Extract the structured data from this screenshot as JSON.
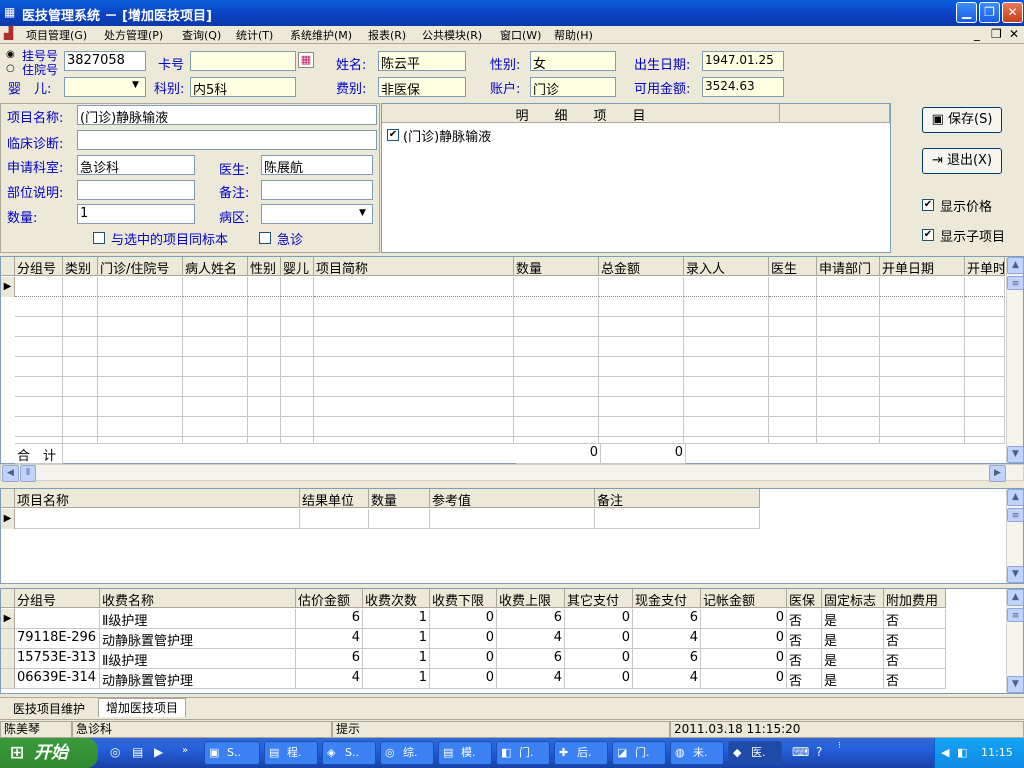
{
  "window": {
    "title": "医技管理系统 － [增加医技项目]"
  },
  "menu": [
    "项目管理(G)",
    "处方管理(P)",
    "查询(Q)",
    "统计(T)",
    "系统维护(M)",
    "报表(R)",
    "公共模块(R)",
    "窗口(W)",
    "帮助(H)"
  ],
  "patient": {
    "radio_reg": "挂号号",
    "radio_inpatient": "住院号",
    "reg_no": "3827058",
    "card_label": "卡号",
    "card_value": "",
    "infant_label": "婴　儿:",
    "infant_value": "",
    "dept_label": "科别:",
    "dept_value": "内5科",
    "name_label": "姓名:",
    "name_value": "陈云平",
    "fee_label": "费别:",
    "fee_value": "非医保",
    "gender_label": "性别:",
    "gender_value": "女",
    "account_label": "账户:",
    "account_value": "门诊",
    "dob_label": "出生日期:",
    "dob_value": "1947.01.25",
    "balance_label": "可用金额:",
    "balance_value": "3524.63"
  },
  "form": {
    "item_name_label": "项目名称:",
    "item_name_value": "(门诊)静脉输液",
    "diagnosis_label": "临床诊断:",
    "diagnosis_value": "",
    "apply_dept_label": "申请科室:",
    "apply_dept_value": "急诊科",
    "doctor_label": "医生:",
    "doctor_value": "陈展航",
    "part_label": "部位说明:",
    "part_value": "",
    "remark_label": "备注:",
    "remark_value": "",
    "qty_label": "数量:",
    "qty_value": "1",
    "ward_label": "病区:",
    "ward_value": "",
    "same_mark_label": "与选中的项目同标本",
    "urgent_label": "急诊"
  },
  "detail": {
    "header": "明　　细　　项　　目",
    "item": "(门诊)静脉输液"
  },
  "actions": {
    "save": "保存(S)",
    "exit": "退出(X)",
    "show_price": "显示价格",
    "show_sub": "显示子项目"
  },
  "grid1": {
    "headers": [
      "分组号",
      "类别",
      "门诊/住院号",
      "病人姓名",
      "性别",
      "婴儿",
      "项目简称",
      "数量",
      "总金额",
      "录入人",
      "医生",
      "申请部门",
      "开单日期",
      "开单时"
    ],
    "total_label": "合　计",
    "total_qty": "0",
    "total_amount": "0"
  },
  "grid2": {
    "headers": [
      "项目名称",
      "结果单位",
      "数量",
      "参考值",
      "备注"
    ]
  },
  "grid3": {
    "headers": [
      "分组号",
      "收费名称",
      "估价金额",
      "收费次数",
      "收费下限",
      "收费上限",
      "其它支付",
      "现金支付",
      "记帐金额",
      "医保",
      "固定标志",
      "附加费用"
    ],
    "rows": [
      [
        "",
        "Ⅱ级护理",
        "6",
        "1",
        "0",
        "6",
        "0",
        "6",
        "0",
        "否",
        "是",
        "否"
      ],
      [
        "79118E-296",
        "动静脉置管护理",
        "4",
        "1",
        "0",
        "4",
        "0",
        "4",
        "0",
        "否",
        "是",
        "否"
      ],
      [
        "15753E-313",
        "Ⅱ级护理",
        "6",
        "1",
        "0",
        "6",
        "0",
        "6",
        "0",
        "否",
        "是",
        "否"
      ],
      [
        "06639E-314",
        "动静脉置管护理",
        "4",
        "1",
        "0",
        "4",
        "0",
        "4",
        "0",
        "否",
        "是",
        "否"
      ]
    ]
  },
  "tabs": [
    "医技项目维护",
    "增加医技项目"
  ],
  "statusbar": {
    "user": "陈美琴",
    "dept": "急诊科",
    "hint": "提示",
    "datetime": "2011.03.18 11:15:20"
  },
  "taskbar": {
    "start": "开始",
    "items": [
      "S..",
      "程.",
      "S..",
      "综.",
      "模.",
      "门.",
      "后.",
      "门.",
      "未.",
      "医."
    ],
    "clock": "11:15"
  },
  "colors": {
    "title": "#0b3fc0",
    "label": "#0000c8",
    "input_yellow": "#ffffe1"
  }
}
